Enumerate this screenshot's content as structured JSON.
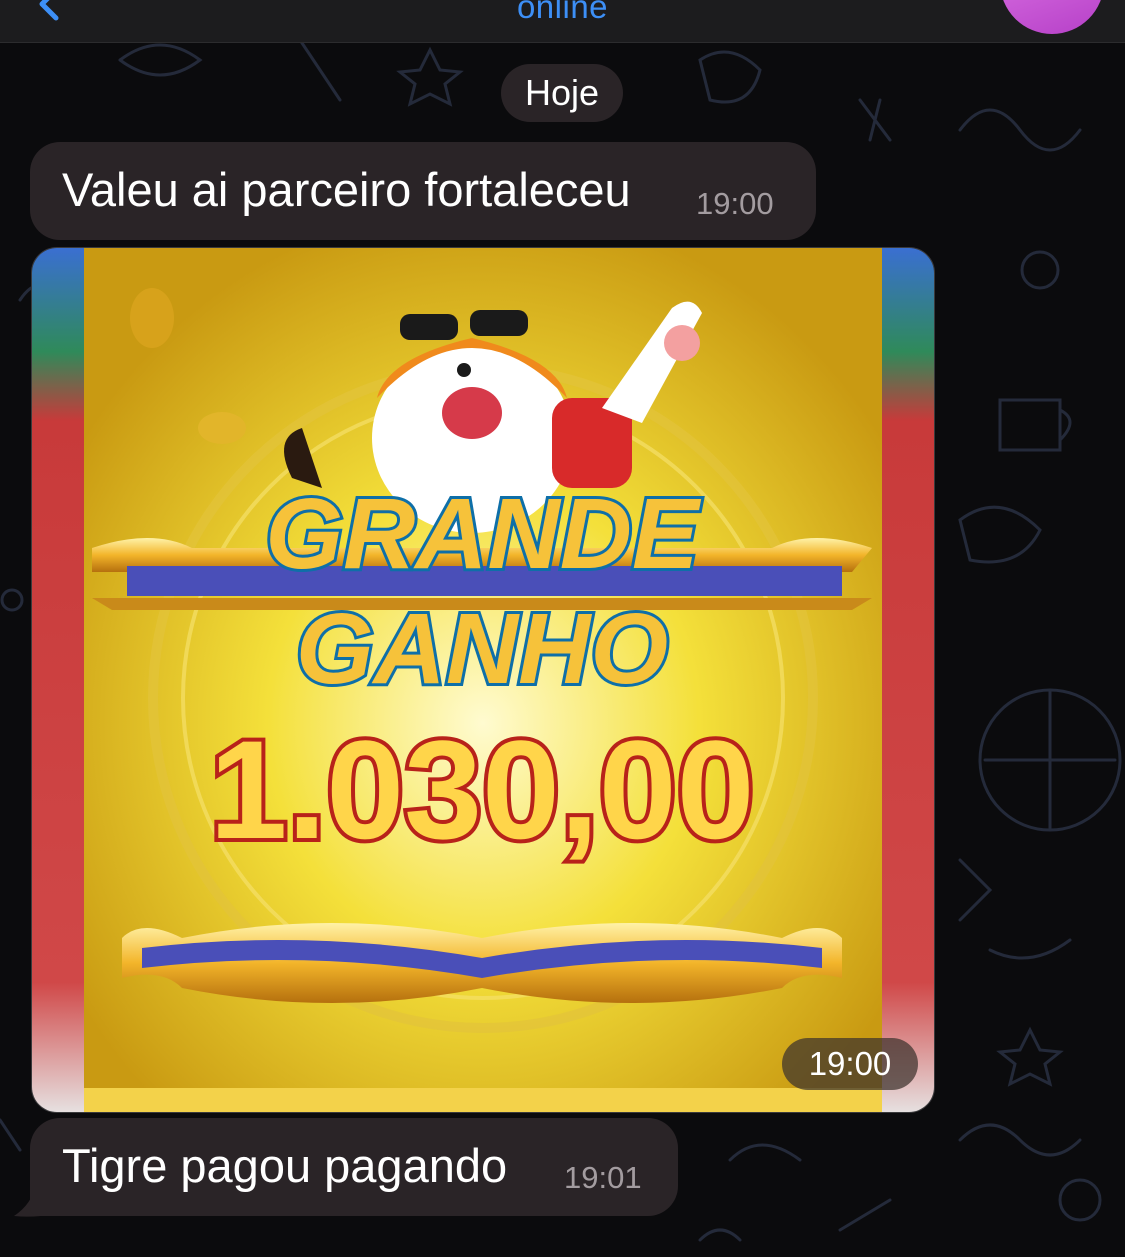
{
  "header": {
    "status": "online",
    "accent_color": "#3d8ff6",
    "back_icon": "chevron-left-icon"
  },
  "chat": {
    "date_separator": "Hoje",
    "messages": [
      {
        "text": "Valeu ai parceiro fortaleceu",
        "time": "19:00"
      },
      {
        "type": "image",
        "time": "19:00",
        "image_text": {
          "line1": "GRANDE",
          "line2": "GANHO",
          "amount": "1.030,00"
        }
      },
      {
        "text": "Tigre pagou pagando",
        "time": "19:01"
      }
    ]
  },
  "colors": {
    "bubble": "#2a2427",
    "background": "#0b0b0d",
    "gold": "#f6c23a"
  }
}
